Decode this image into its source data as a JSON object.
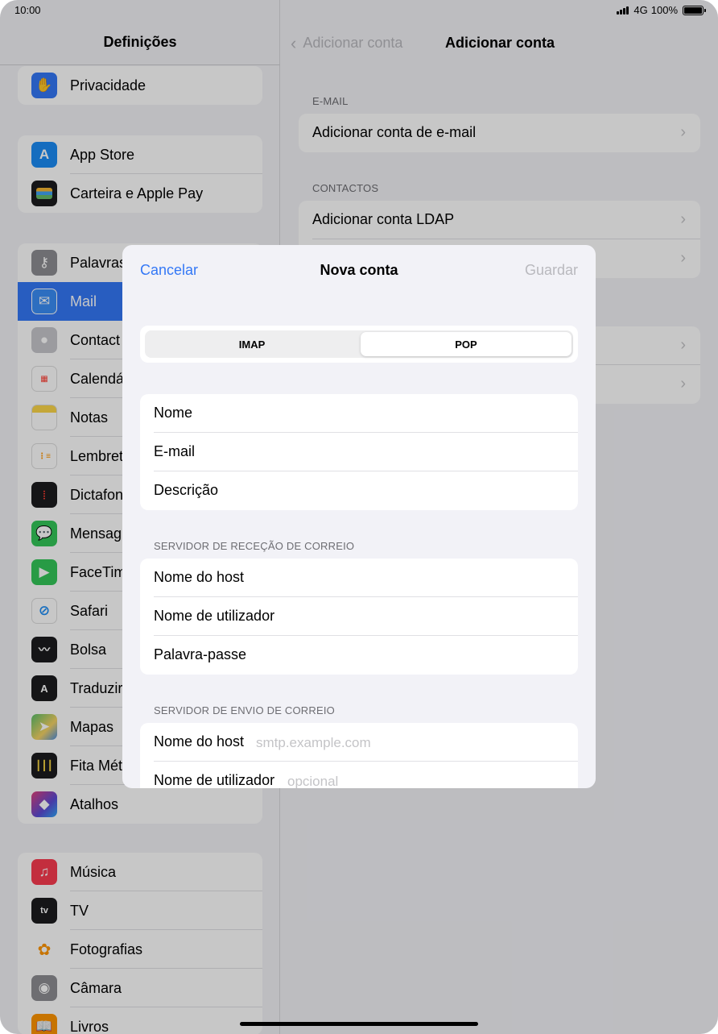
{
  "status": {
    "time": "10:00",
    "network": "4G",
    "battery": "100%"
  },
  "sidebar": {
    "title": "Definições",
    "groups": [
      {
        "items": [
          {
            "label": "Privacidade",
            "icon": "hand-icon",
            "color": "#3478f6"
          }
        ]
      },
      {
        "items": [
          {
            "label": "App Store",
            "icon": "app-store-icon",
            "color": "#1b8cf5"
          },
          {
            "label": "Carteira e Apple Pay",
            "icon": "wallet-icon",
            "color": "#1c1c1e"
          }
        ]
      },
      {
        "items": [
          {
            "label": "Palavras",
            "icon": "key-icon",
            "color": "#8e8e93"
          },
          {
            "label": "Mail",
            "icon": "mail-icon",
            "color": "#3a8ef6",
            "selected": true
          },
          {
            "label": "Contact",
            "icon": "contacts-icon",
            "color": "#a8a8ad"
          },
          {
            "label": "Calendá",
            "icon": "calendar-icon",
            "color": "#ffffff"
          },
          {
            "label": "Notas",
            "icon": "notes-icon",
            "color": "#fbd64a"
          },
          {
            "label": "Lembret",
            "icon": "reminders-icon",
            "color": "#ffffff"
          },
          {
            "label": "Dictafon",
            "icon": "voice-memos-icon",
            "color": "#1c1c1e"
          },
          {
            "label": "Mensag",
            "icon": "messages-icon",
            "color": "#34c759"
          },
          {
            "label": "FaceTim",
            "icon": "facetime-icon",
            "color": "#34c759"
          },
          {
            "label": "Safari",
            "icon": "safari-icon",
            "color": "#ffffff"
          },
          {
            "label": "Bolsa",
            "icon": "stocks-icon",
            "color": "#1c1c1e"
          },
          {
            "label": "Traduzir",
            "icon": "translate-icon",
            "color": "#1c1c1e"
          },
          {
            "label": "Mapas",
            "icon": "maps-icon",
            "color": "#5ac06a"
          },
          {
            "label": "Fita Mét",
            "icon": "measure-icon",
            "color": "#1c1c1e"
          },
          {
            "label": "Atalhos",
            "icon": "shortcuts-icon",
            "color": "#5b4bd6"
          }
        ]
      },
      {
        "items": [
          {
            "label": "Música",
            "icon": "music-icon",
            "color": "#fa3b50"
          },
          {
            "label": "TV",
            "icon": "tv-icon",
            "color": "#1c1c1e"
          },
          {
            "label": "Fotografias",
            "icon": "photos-icon",
            "color": "#ffffff"
          },
          {
            "label": "Câmara",
            "icon": "camera-icon",
            "color": "#8e8e93"
          },
          {
            "label": "Livros",
            "icon": "books-icon",
            "color": "#ff9500"
          }
        ]
      }
    ]
  },
  "detail": {
    "back_label": "Adicionar conta",
    "title": "Adicionar conta",
    "email_header": "E-MAIL",
    "email_items": [
      "Adicionar conta de e-mail"
    ],
    "contacts_header": "CONTACTOS",
    "contacts_items": [
      "Adicionar conta LDAP",
      ""
    ],
    "other_items": [
      "",
      ""
    ]
  },
  "modal": {
    "cancel": "Cancelar",
    "title": "Nova conta",
    "save": "Guardar",
    "segments": [
      "IMAP",
      "POP"
    ],
    "selected_segment": "POP",
    "account_fields": [
      "Nome",
      "E-mail",
      "Descrição"
    ],
    "incoming_header": "SERVIDOR DE RECEÇÃO DE CORREIO",
    "incoming_fields": [
      "Nome do host",
      "Nome de utilizador",
      "Palavra-passe"
    ],
    "outgoing_header": "SERVIDOR DE ENVIO DE CORREIO",
    "outgoing_fields": [
      {
        "label": "Nome do host",
        "placeholder": "smtp.example.com"
      },
      {
        "label": "Nome de utilizador",
        "placeholder": "opcional"
      }
    ]
  }
}
